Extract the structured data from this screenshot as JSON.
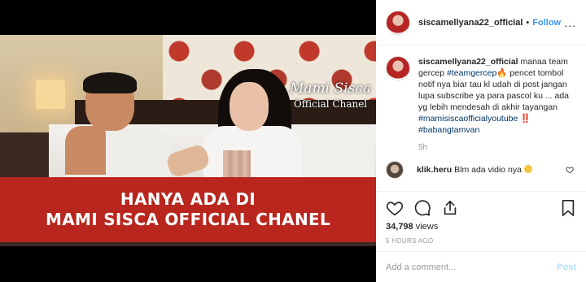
{
  "video": {
    "watermark_line1": "Mami Sisca",
    "watermark_line2": "Official Chanel",
    "banner_line1": "HANYA ADA DI",
    "banner_line2": "MAMI SISCA OFFICIAL CHANEL"
  },
  "header": {
    "username": "siscamellyana22_official",
    "separator": "•",
    "follow_label": "Follow",
    "more_label": "..."
  },
  "caption": {
    "username": "siscamellyana22_official",
    "text_part1": "manaa team gercep",
    "hashtag1": "#teamgercep",
    "fire_emoji": "🔥",
    "text_part2": "pencet tombol notif nya biar tau kl udah di post jangan lupa subscribe ya para pascol ku ... ada yg lebih mendesah di akhir tayangan",
    "hashtag2": "#mamisiscaofficialyoutube",
    "hashtag2_suffix": "‼️",
    "hashtag3": "#babangtamvan",
    "time": "5h"
  },
  "comment": {
    "username": "klik.heru",
    "text": "Blm ada vidio nya"
  },
  "stats": {
    "views_count": "34,798",
    "views_label": "views",
    "posted_ago": "5 HOURS AGO"
  },
  "add_comment": {
    "placeholder": "Add a comment...",
    "post_label": "Post"
  }
}
